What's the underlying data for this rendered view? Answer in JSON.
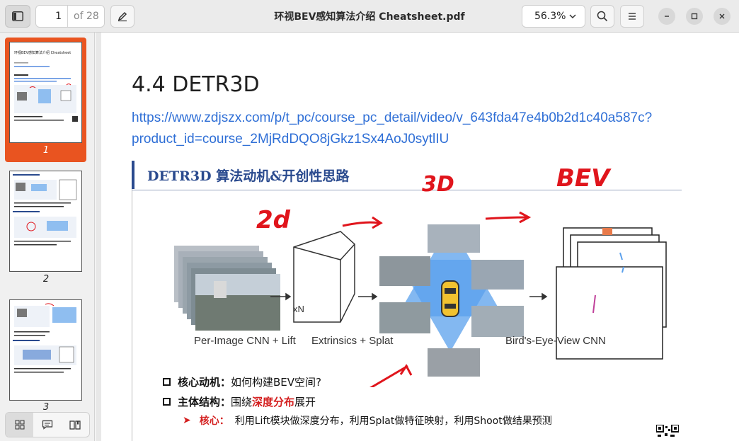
{
  "toolbar": {
    "current_page": "1",
    "of_pages": "of 28",
    "title": "环视BEV感知算法介绍 Cheatsheet.pdf",
    "zoom": "56.3%"
  },
  "sidebar": {
    "thumbs": [
      {
        "num": "1",
        "title": "环视BEV感知算法介绍 Cheatsheet"
      },
      {
        "num": "2"
      },
      {
        "num": "3"
      }
    ]
  },
  "doc": {
    "heading": "4.4 DETR3D",
    "link": "https://www.zdjszx.com/p/t_pc/course_pc_detail/video/v_643fda47e4b0b2d1c40a587c?product_id=course_2MjRdDQO8jGkz1Sx4AoJ0sytlIU",
    "slide": {
      "title": "DETR3D 算法动机&开创性思路",
      "captions": [
        "Per-Image CNN + Lift",
        "Extrinsics + Splat",
        "Bird's-Eye-View CNN"
      ],
      "xn": "xN",
      "handwriting": [
        "2d",
        "3D",
        "BEV"
      ],
      "bullets": [
        {
          "label": "核心动机：",
          "text": "如何构建BEV空间?"
        },
        {
          "label": "主体结构：",
          "text_before": "围绕",
          "highlight": "深度分布",
          "text_after": "展开"
        },
        {
          "label": "核心：",
          "text": "利用Lift模块做深度分布，利用Splat做特征映射，利用Shoot做结果预测"
        }
      ]
    }
  }
}
